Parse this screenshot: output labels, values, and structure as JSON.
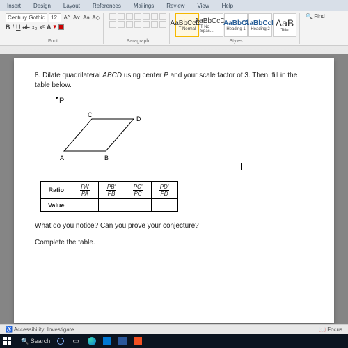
{
  "ribbon": {
    "tabs": [
      "Insert",
      "Design",
      "Layout",
      "References",
      "Mailings",
      "Review",
      "View",
      "Help"
    ],
    "font_name": "Century Gothic",
    "font_size": "12",
    "grow_font": "A^",
    "shrink_font": "A˅",
    "case": "Aa",
    "clear_fmt": "A◇",
    "bold": "B",
    "italic": "I",
    "underline": "U",
    "strike": "ab",
    "subscript": "x₂",
    "superscript": "x²",
    "font_color_swatch": "#c00000",
    "styles": [
      {
        "sample": "AaBbCcDc",
        "name": "T Normal"
      },
      {
        "sample": "AaBbCcDc",
        "name": "T No Spac..."
      },
      {
        "sample": "AaBbCi",
        "name": "Heading 1"
      },
      {
        "sample": "AaBbCcE",
        "name": "Heading 2"
      },
      {
        "sample": "AaB",
        "name": "Title"
      }
    ],
    "find_label": "Find",
    "group_font": "Font",
    "group_para": "Paragraph",
    "group_styles": "Styles"
  },
  "document": {
    "problem_number": "8.",
    "problem_prefix": "Dilate quadrilateral ",
    "problem_quad": "ABCD",
    "problem_mid": " using center ",
    "problem_p": "P",
    "problem_tail": " and your scale factor of 3. Then, fill in the table below.",
    "point_label": "P",
    "vertexA": "A",
    "vertexB": "B",
    "vertexC": "C",
    "vertexD": "D",
    "table": {
      "row1_label": "Ratio",
      "row2_label": "Value",
      "col1_num": "PA'",
      "col1_den": "PA",
      "col2_num": "PB'",
      "col2_den": "PB",
      "col3_num": "PC'",
      "col3_den": "PC",
      "col4_num": "PD'",
      "col4_den": "PD"
    },
    "q1": "What do you notice? Can you prove your conjecture?",
    "q2": "Complete the table."
  },
  "status": {
    "accessibility": "Accessibility: Investigate",
    "focus": "Focus"
  },
  "taskbar": {
    "search_placeholder": "Search"
  }
}
